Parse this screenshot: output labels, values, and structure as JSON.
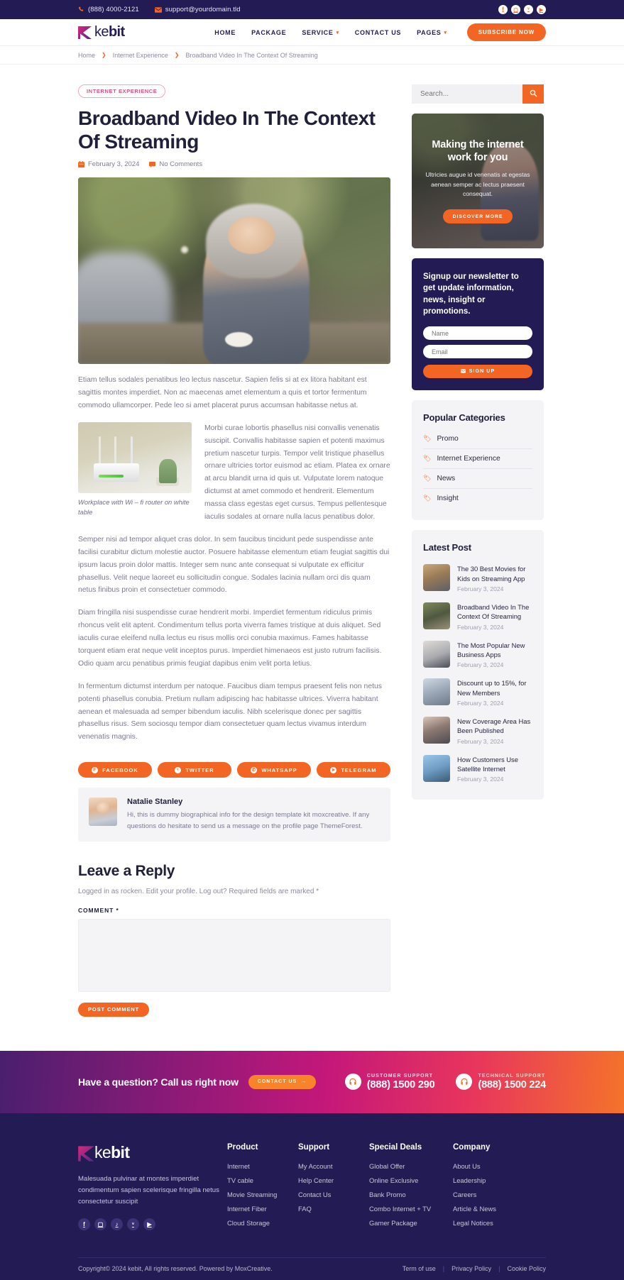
{
  "topbar": {
    "phone": "(888) 4000-2121",
    "email": "support@yourdomain.tld",
    "socials": [
      "f",
      "▢",
      "ᵛ",
      "▶"
    ]
  },
  "header": {
    "brand_ke": "ke",
    "brand_bit": "bit",
    "nav": [
      {
        "label": "HOME",
        "caret": false
      },
      {
        "label": "PACKAGE",
        "caret": false
      },
      {
        "label": "SERVICE",
        "caret": true
      },
      {
        "label": "CONTACT US",
        "caret": false
      },
      {
        "label": "PAGES",
        "caret": true
      }
    ],
    "subscribe_label": "SUBSCRIBE NOW"
  },
  "breadcrumb": {
    "home": "Home",
    "category": "Internet Experience",
    "current": "Broadband Video In The Context Of Streaming"
  },
  "article": {
    "tag": "INTERNET EXPERIENCE",
    "title": "Broadband Video In The Context Of Streaming",
    "date": "February 3, 2024",
    "comments": "No Comments",
    "p1": "Etiam tellus sodales penatibus leo lectus nascetur. Sapien felis si at ex litora habitant est sagittis montes imperdiet. Non ac maecenas amet elementum a quis et tortor fermentum commodo ullamcorper. Pede leo si amet placerat purus accumsan habitasse netus at.",
    "p2": "Morbi curae lobortis phasellus nisi convallis venenatis suscipit. Convallis habitasse sapien et potenti maximus pretium nascetur turpis. Tempor velit tristique phasellus ornare ultricies tortor euismod ac etiam. Platea ex ornare at arcu blandit urna id quis ut. Vulputate lorem natoque dictumst at amet commodo et hendrerit. Elementum massa class egestas eget cursus. Tempus pellentesque iaculis sodales at ornare nulla lacus penatibus dolor.",
    "p3": "Semper nisi ad tempor aliquet cras dolor. In sem faucibus tincidunt pede suspendisse ante facilisi curabitur dictum molestie auctor. Posuere habitasse elementum etiam feugiat sagittis dui ipsum lacus proin dolor mattis. Integer sem nunc ante consequat si vulputate ex efficitur phasellus. Velit neque laoreet eu sollicitudin congue. Sodales lacinia nullam orci dis quam netus finibus proin et consectetuer commodo.",
    "p4": "Diam fringilla nisi suspendisse curae hendrerit morbi. Imperdiet fermentum ridiculus primis rhoncus velit elit aptent. Condimentum tellus porta viverra fames tristique at duis aliquet. Sed iaculis curae eleifend nulla lectus eu risus mollis orci conubia maximus. Fames habitasse torquent etiam erat neque velit inceptos purus. Imperdiet himenaeos est justo rutrum facilisis. Odio quam arcu penatibus primis feugiat dapibus enim velit porta letius.",
    "p5": "In fermentum dictumst interdum per natoque. Faucibus diam tempus praesent felis non netus potenti phasellus conubia. Pretium nullam adipiscing hac habitasse ultrices. Viverra habitant aenean et malesuada ad semper bibendum iaculis. Nibh scelerisque donec per sagittis phasellus risus. Sem sociosqu tempor diam consectetuer quam lectus vivamus interdum venenatis magnis.",
    "figure_caption": "Workplace with Wi – fi router on white table",
    "share": [
      {
        "label": "FACEBOOK",
        "glyph": "f"
      },
      {
        "label": "TWITTER",
        "glyph": "ᵛ"
      },
      {
        "label": "WHATSAPP",
        "glyph": "✆"
      },
      {
        "label": "TELEGRAM",
        "glyph": "➤"
      }
    ],
    "author_name": "Natalie Stanley",
    "author_bio": "Hi, this is dummy biographical info for the design template kit moxcreative. If any questions do hesitate to send us a message on the profile page ThemeForest."
  },
  "comment_form": {
    "title": "Leave a Reply",
    "logged_in": "Logged in as rocken. Edit your profile. Log out? Required fields are marked *",
    "comment_label": "COMMENT *",
    "comment_value": "",
    "submit_label": "POST COMMENT"
  },
  "sidebar": {
    "search_placeholder": "Search...",
    "promo": {
      "title": "Making the internet work for you",
      "text": "Ultricies augue id venenatis at egestas aenean semper ac lectus praesent consequat.",
      "button": "DISCOVER MORE"
    },
    "newsletter": {
      "title": "Signup our newsletter to get update information, news, insight or promotions.",
      "name_placeholder": "Name",
      "email_placeholder": "Email",
      "button": "SIGN UP"
    },
    "categories_title": "Popular Categories",
    "categories": [
      "Promo",
      "Internet Experience",
      "News",
      "Insight"
    ],
    "latest_title": "Latest Post",
    "latest": [
      {
        "title": "The 30 Best Movies for Kids on Streaming App",
        "date": "February 3, 2024"
      },
      {
        "title": "Broadband Video In The Context Of Streaming",
        "date": "February 3, 2024"
      },
      {
        "title": "The Most Popular New Business Apps",
        "date": "February 3, 2024"
      },
      {
        "title": "Discount up to 15%, for New Members",
        "date": "February 3, 2024"
      },
      {
        "title": "New Coverage Area Has Been Published",
        "date": "February 3, 2024"
      },
      {
        "title": "How Customers Use Satellite Internet",
        "date": "February 3, 2024"
      }
    ]
  },
  "cta": {
    "question": "Have a question? Call us right now",
    "button": "CONTACT US",
    "customer_label": "CUSTOMER SUPPORT",
    "customer_number": "(888) 1500 290",
    "technical_label": "TECHNICAL SUPPORT",
    "technical_number": "(888) 1500 224"
  },
  "footer": {
    "brand_ke": "ke",
    "brand_bit": "bit",
    "about": "Malesuada pulvinar at montes imperdiet condimentum sapien scelerisque fringilla netus consectetur suscipit",
    "socials": [
      "f",
      "▢",
      "♪",
      "ᵛ",
      "▶"
    ],
    "columns": [
      {
        "title": "Product",
        "links": [
          "Internet",
          "TV cable",
          "Movie Streaming",
          "Internet Fiber",
          "Cloud Storage"
        ]
      },
      {
        "title": "Support",
        "links": [
          "My Account",
          "Help Center",
          "Contact Us",
          "FAQ"
        ]
      },
      {
        "title": "Special Deals",
        "links": [
          "Global Offer",
          "Online Exclusive",
          "Bank Promo",
          "Combo Internet + TV",
          "Gamer Package"
        ]
      },
      {
        "title": "Company",
        "links": [
          "About Us",
          "Leadership",
          "Careers",
          "Article & News",
          "Legal Notices"
        ]
      }
    ],
    "copyright": "Copyright© 2024 kebit, All rights reserved. Powered by MoxCreative.",
    "bottom_links": [
      "Term of use",
      "Privacy Policy",
      "Cookie Policy"
    ]
  },
  "colors": {
    "accent": "#f26522",
    "navy": "#231b54",
    "pink": "#d6537f"
  }
}
